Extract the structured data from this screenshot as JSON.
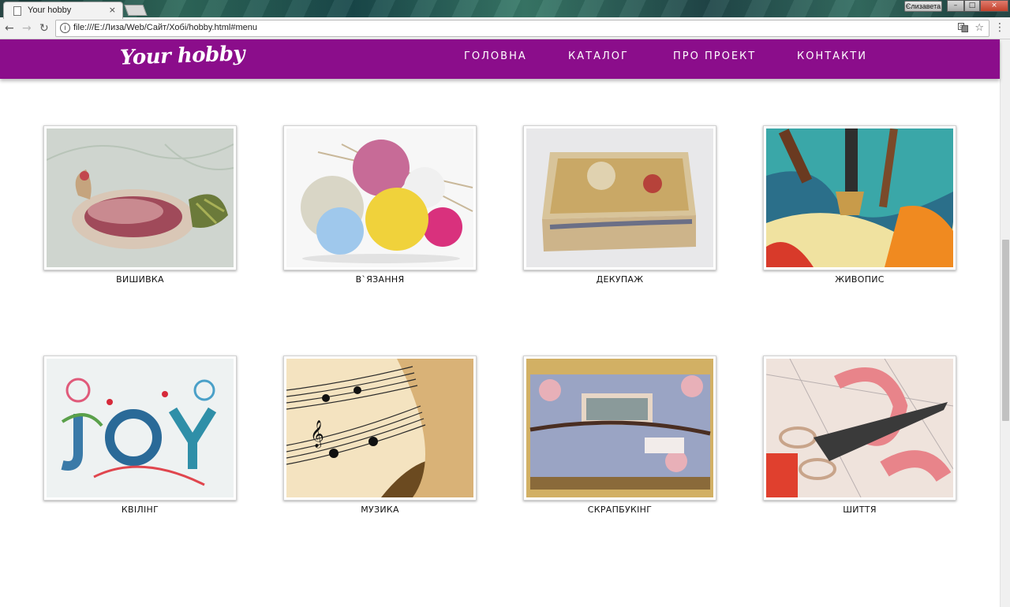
{
  "browser": {
    "tab_title": "Your hobby",
    "tab_close": "×",
    "profile_name": "Єлизавета",
    "url": "file:///E:/Лиза/Web/Сайт/Хобі/hobby.html#menu",
    "back_icon": "←",
    "forward_icon": "→",
    "reload_icon": "↻",
    "star_icon": "☆",
    "menu_icon": "⋮"
  },
  "site": {
    "logo": "Your hobby",
    "brand_color": "#8b0d8b",
    "menu": [
      {
        "label": "ГОЛОВНА"
      },
      {
        "label": "КАТАЛОГ"
      },
      {
        "label": "ПРО ПРОЕКТ"
      },
      {
        "label": "КОНТАКТИ"
      }
    ]
  },
  "catalog": [
    {
      "label": "ВИШИВКА",
      "image": "embroidery-bird"
    },
    {
      "label": "В`ЯЗАННЯ",
      "image": "yarn-balls"
    },
    {
      "label": "ДЕКУПАЖ",
      "image": "decoupage-box"
    },
    {
      "label": "ЖИВОПИС",
      "image": "paint-brushes"
    },
    {
      "label": "КВІЛІНГ",
      "image": "quilling-joy"
    },
    {
      "label": "МУЗИКА",
      "image": "sheet-music"
    },
    {
      "label": "СКРАПБУКІНГ",
      "image": "scrapbook-album"
    },
    {
      "label": "ШИТТЯ",
      "image": "scissors-tape"
    }
  ]
}
